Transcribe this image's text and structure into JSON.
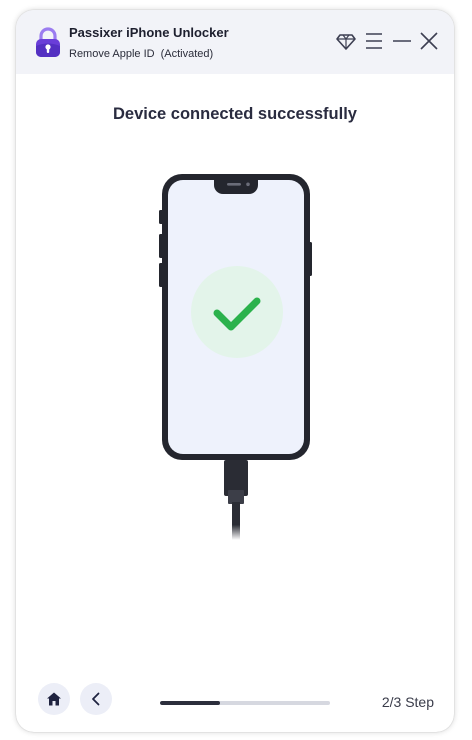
{
  "app": {
    "title": "Passixer iPhone Unlocker",
    "mode": "Remove Apple ID",
    "status": "(Activated)"
  },
  "titlebar": {
    "icons": [
      "diamond-icon",
      "menu-icon",
      "minimize-icon",
      "close-icon"
    ]
  },
  "main": {
    "heading": "Device connected successfully",
    "illustration_icon": "checkmark-icon"
  },
  "footer": {
    "home_icon": "home-icon",
    "back_icon": "chevron-left-icon",
    "progress_fraction": 0.35,
    "step_label": "2/3 Step"
  },
  "colors": {
    "accent_purple": "#6a3ed8",
    "success_green": "#2bb24c",
    "titlebar_bg": "#f2f3f8",
    "phone_body": "#24262e",
    "phone_screen": "#eef2fc"
  }
}
